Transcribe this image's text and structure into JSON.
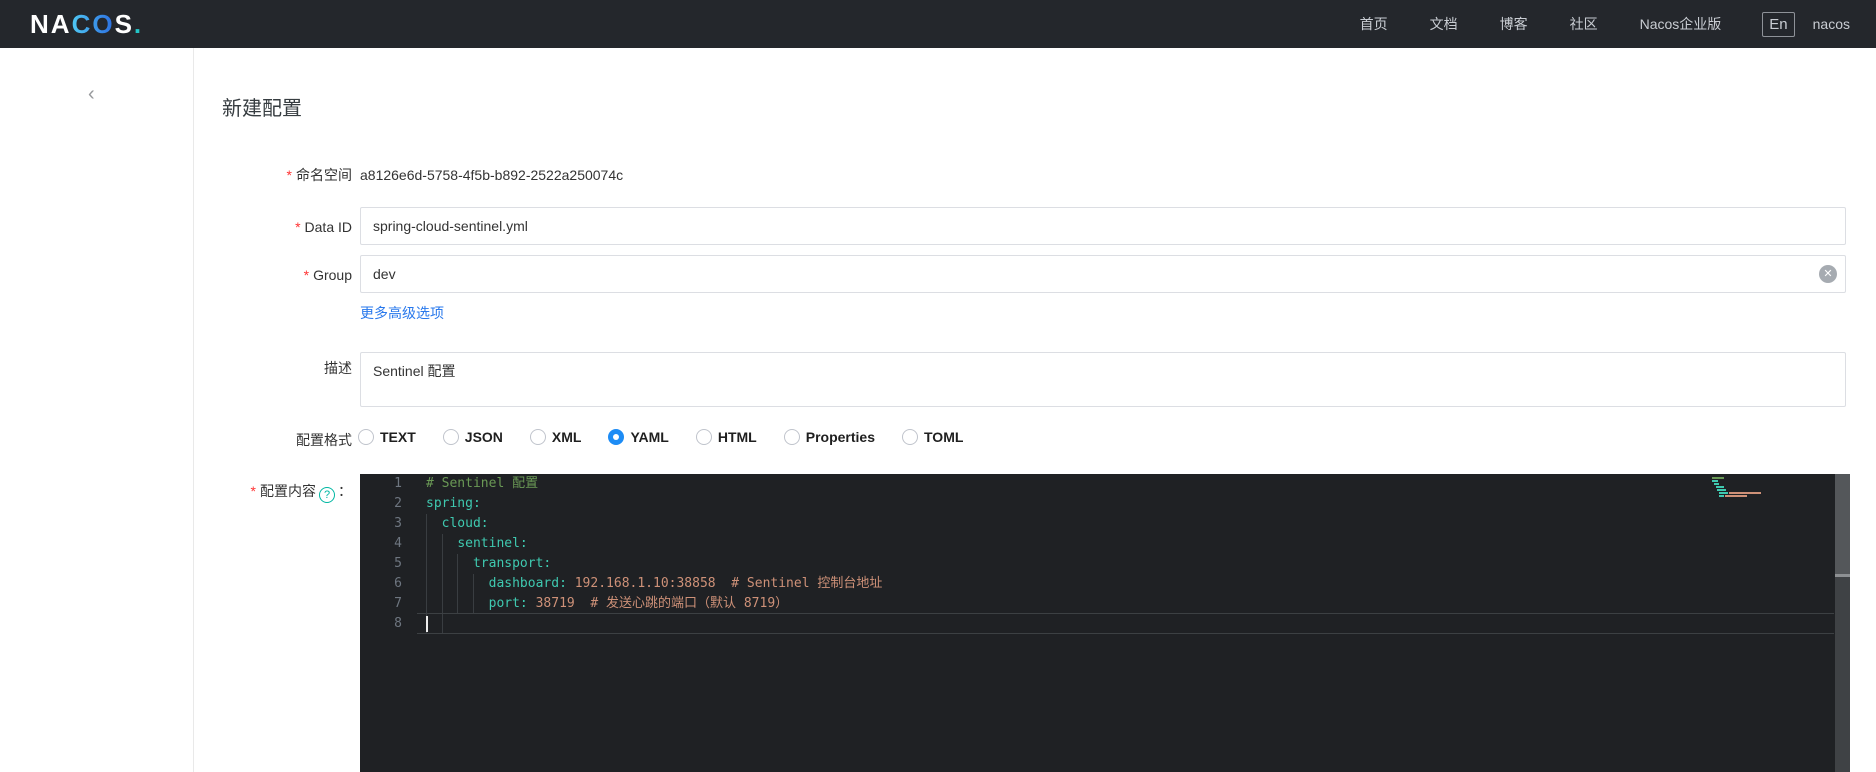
{
  "navbar": {
    "logo": {
      "pre": "NA",
      "mid": "CO",
      "post": "S",
      "dot": "."
    },
    "items": [
      "首页",
      "文档",
      "博客",
      "社区",
      "Nacos企业版"
    ],
    "lang": "En",
    "username": "nacos"
  },
  "page": {
    "back_icon": "‹",
    "title": "新建配置"
  },
  "form": {
    "required_mark": "*",
    "namespace": {
      "label": "命名空间",
      "value": "a8126e6d-5758-4f5b-b892-2522a250074c"
    },
    "data_id": {
      "label": "Data ID",
      "value": "spring-cloud-sentinel.yml"
    },
    "group": {
      "label": "Group",
      "value": "dev",
      "clear_icon": "✕"
    },
    "more_link": "更多高级选项",
    "description": {
      "label": "描述",
      "value": "Sentinel 配置"
    },
    "format": {
      "label": "配置格式",
      "options": [
        "TEXT",
        "JSON",
        "XML",
        "YAML",
        "HTML",
        "Properties",
        "TOML"
      ],
      "selected": "YAML"
    },
    "content": {
      "label": "配置内容",
      "help_icon": "?",
      "colon": "："
    }
  },
  "editor": {
    "language": "yaml",
    "lines": [
      {
        "n": "1",
        "parts": [
          [
            "# Sentinel 配置",
            "cm"
          ]
        ]
      },
      {
        "n": "2",
        "parts": [
          [
            "spring:",
            "key"
          ]
        ]
      },
      {
        "n": "3",
        "parts": [
          [
            "  ",
            "plain"
          ],
          [
            "cloud:",
            "key"
          ]
        ]
      },
      {
        "n": "4",
        "parts": [
          [
            "    ",
            "plain"
          ],
          [
            "sentinel:",
            "key"
          ]
        ]
      },
      {
        "n": "5",
        "parts": [
          [
            "      ",
            "plain"
          ],
          [
            "transport:",
            "key"
          ]
        ]
      },
      {
        "n": "6",
        "parts": [
          [
            "        ",
            "plain"
          ],
          [
            "dashboard:",
            "key"
          ],
          [
            " 192.168.1.10:38858  # Sentinel 控制台地址",
            "val"
          ]
        ]
      },
      {
        "n": "7",
        "parts": [
          [
            "        ",
            "plain"
          ],
          [
            "port:",
            "key"
          ],
          [
            " 38719  # 发送心跳的端口（默认 8719）",
            "val"
          ]
        ]
      },
      {
        "n": "8",
        "parts": [],
        "cursor": true,
        "current": true
      }
    ]
  },
  "colors": {
    "navbar_bg": "#24272c",
    "logo_dot": "#23c6c8",
    "link_blue": "#2878ec",
    "radio_selected_blue": "#1d8cf5",
    "required_red": "#ff3333",
    "help_icon_teal": "#00b7a3",
    "editor_bg": "#1f2124",
    "editor_comment": "#6a9955",
    "editor_key": "#3fc9b0",
    "editor_value": "#ce9178",
    "editor_line_number": "#6e7680"
  }
}
